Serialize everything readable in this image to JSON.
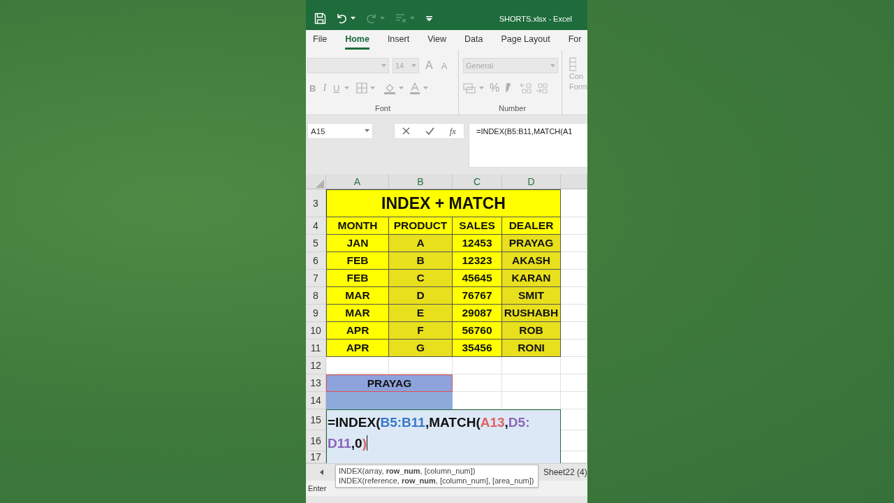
{
  "window": {
    "title": "SHORTS.xlsx  -  Excel"
  },
  "tabs": [
    {
      "label": "File",
      "selected": false
    },
    {
      "label": "Home",
      "selected": true
    },
    {
      "label": "Insert",
      "selected": false
    },
    {
      "label": "View",
      "selected": false
    },
    {
      "label": "Data",
      "selected": false
    },
    {
      "label": "Page Layout",
      "selected": false
    },
    {
      "label": "For",
      "selected": false
    }
  ],
  "ribbon": {
    "disabled": true,
    "font_group": {
      "label": "Font",
      "font_size": "14",
      "size_buttons": [
        "A",
        "A"
      ],
      "format_buttons": [
        "B",
        "I",
        "U"
      ]
    },
    "number_group": {
      "label": "Number",
      "format": "General",
      "percent": "%"
    },
    "styles_group": {
      "lines": [
        "Con",
        "Form"
      ]
    }
  },
  "formula_bar": {
    "name_box": "A15",
    "function_label": "fx",
    "formula": "=INDEX(B5:B11,MATCH(A1"
  },
  "sheet": {
    "columns": [
      {
        "label": "A",
        "highlighted": false
      },
      {
        "label": "B",
        "highlighted": true
      },
      {
        "label": "C",
        "highlighted": false
      },
      {
        "label": "D",
        "highlighted": true
      }
    ],
    "rows": [
      {
        "number": "3",
        "kind": "title",
        "text": "INDEX + MATCH"
      },
      {
        "number": "4",
        "kind": "header",
        "cells": [
          "MONTH",
          "PRODUCT",
          "SALES",
          "DEALER"
        ]
      },
      {
        "number": "5",
        "kind": "data",
        "cells": [
          "JAN",
          "A",
          "12453",
          "PRAYAG"
        ]
      },
      {
        "number": "6",
        "kind": "data",
        "cells": [
          "FEB",
          "B",
          "12323",
          "AKASH"
        ]
      },
      {
        "number": "7",
        "kind": "data",
        "cells": [
          "FEB",
          "C",
          "45645",
          "KARAN"
        ]
      },
      {
        "number": "8",
        "kind": "data",
        "cells": [
          "MAR",
          "D",
          "76767",
          "SMIT"
        ]
      },
      {
        "number": "9",
        "kind": "data",
        "cells": [
          "MAR",
          "E",
          "29087",
          "RUSHABH"
        ]
      },
      {
        "number": "10",
        "kind": "data",
        "cells": [
          "APR",
          "F",
          "56760",
          "ROB"
        ]
      },
      {
        "number": "11",
        "kind": "data",
        "cells": [
          "APR",
          "G",
          "35456",
          "RONI"
        ]
      },
      {
        "number": "12",
        "kind": "empty"
      },
      {
        "number": "13",
        "kind": "result",
        "text": "PRAYAG"
      },
      {
        "number": "14",
        "kind": "fill"
      },
      {
        "number": "15",
        "kind": "edit"
      },
      {
        "number": "16",
        "kind": "edit"
      },
      {
        "number": "17",
        "kind": "edit"
      }
    ],
    "cell_editor": {
      "lines": [
        [
          {
            "text": "=INDEX(",
            "color": "#111111"
          },
          {
            "text": "B5:B11",
            "color": "#3b78c8"
          },
          {
            "text": ",MATCH(",
            "color": "#111111"
          },
          {
            "text": "A13",
            "color": "#e06060"
          },
          {
            "text": ",",
            "color": "#111111"
          },
          {
            "text": "D5:",
            "color": "#8a64b8"
          }
        ],
        [
          {
            "text": "D11",
            "color": "#8a64b8"
          },
          {
            "text": ",0",
            "color": "#111111"
          },
          {
            "text": ")",
            "color": "#e06060"
          }
        ]
      ]
    }
  },
  "tooltip": {
    "lines": [
      "INDEX(array, **row_num**, [column_num])",
      "INDEX(reference, **row_num**, [column_num], [area_num])"
    ]
  },
  "sheet_tabs": [
    {
      "label": "Sheet22 (4)"
    }
  ],
  "status_bar": {
    "mode": "Enter"
  }
}
